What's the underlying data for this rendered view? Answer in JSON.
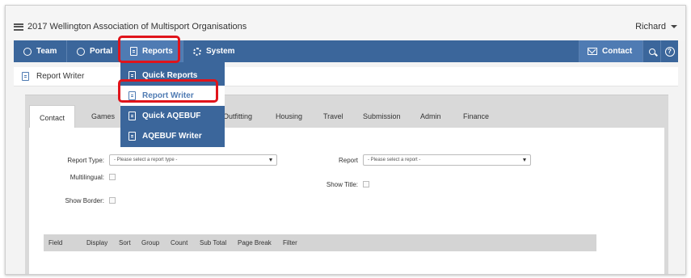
{
  "app": {
    "title": "2017 Wellington Association of Multisport Organisations",
    "user": "Richard"
  },
  "nav": {
    "items": [
      {
        "label": "Team",
        "icon": "globe-icon"
      },
      {
        "label": "Portal",
        "icon": "globe-icon"
      },
      {
        "label": "Reports",
        "icon": "report-icon"
      },
      {
        "label": "System",
        "icon": "gear-icon"
      }
    ],
    "contact_label": "Contact",
    "search_icon": "search-icon",
    "help_icon": "help-icon",
    "help_glyph": "?"
  },
  "reports_menu": {
    "items": [
      {
        "label": "Quick Reports"
      },
      {
        "label": "Report Writer"
      },
      {
        "label": "Quick AQEBUF"
      },
      {
        "label": "AQEBUF Writer"
      }
    ],
    "selected": "Report Writer"
  },
  "page": {
    "title": "Report Writer"
  },
  "tabs": [
    "Contact",
    "Games",
    "Outfitting",
    "Housing",
    "Travel",
    "Submission",
    "Admin",
    "Finance"
  ],
  "active_tab": "Contact",
  "form": {
    "report_type_label": "Report Type:",
    "report_type_value": "- Please select a report type -",
    "report_label": "Report",
    "report_value": "- Please select a report -",
    "multilingual_label": "Multilingual:",
    "show_title_label": "Show Title:",
    "show_border_label": "Show Border:"
  },
  "grid": {
    "columns": [
      "Field",
      "Display",
      "Sort",
      "Group",
      "Count",
      "Sub Total",
      "Page Break",
      "Filter"
    ]
  },
  "colors": {
    "nav_bg": "#3b669b",
    "highlight": "#e0141b"
  }
}
